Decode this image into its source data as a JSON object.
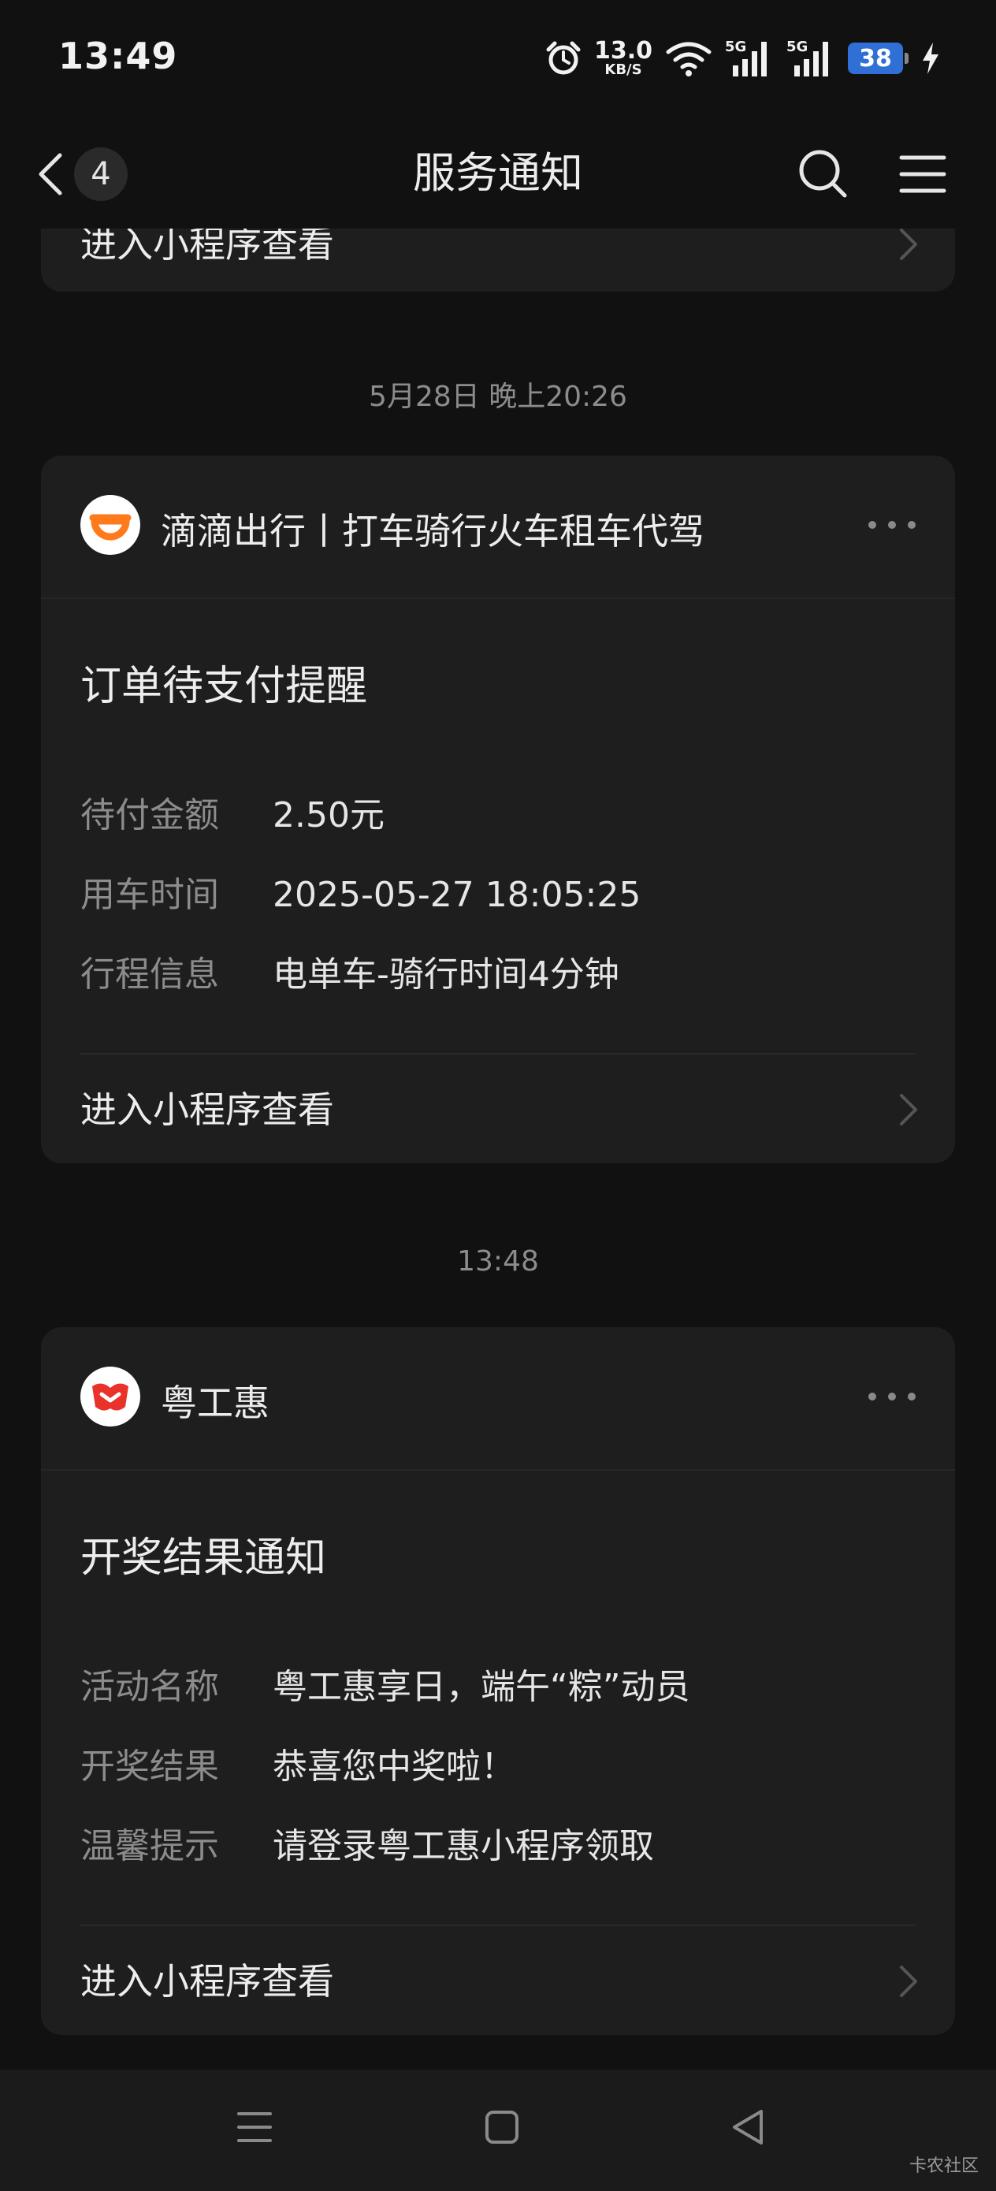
{
  "status_bar": {
    "time": "13:49",
    "net_speed_value": "13.0",
    "net_speed_unit": "KB/S",
    "signal_1_label": "5G",
    "signal_2_label": "5G",
    "battery_level": "38"
  },
  "nav": {
    "unread_count": "4",
    "title": "服务通知"
  },
  "messages": [
    {
      "link_label": "进入小程序查看"
    },
    {
      "timestamp": "5月28日 晚上20:26",
      "app_name": "滴滴出行丨打车骑行火车租车代驾",
      "title": "订单待支付提醒",
      "fields": [
        {
          "label": "待付金额",
          "value": "2.50元"
        },
        {
          "label": "用车时间",
          "value": "2025-05-27 18:05:25"
        },
        {
          "label": "行程信息",
          "value": "电单车-骑行时间4分钟"
        }
      ],
      "link_label": "进入小程序查看",
      "logo_color": "#ff7a1a"
    },
    {
      "timestamp": "13:48",
      "app_name": "粤工惠",
      "title": "开奖结果通知",
      "fields": [
        {
          "label": "活动名称",
          "value": "粤工惠享日，端午“粽”动员"
        },
        {
          "label": "开奖结果",
          "value": "恭喜您中奖啦！"
        },
        {
          "label": "温馨提示",
          "value": "请登录粤工惠小程序领取"
        }
      ],
      "link_label": "进入小程序查看",
      "logo_color": "#e8322a"
    }
  ],
  "watermark": "卡农社区"
}
